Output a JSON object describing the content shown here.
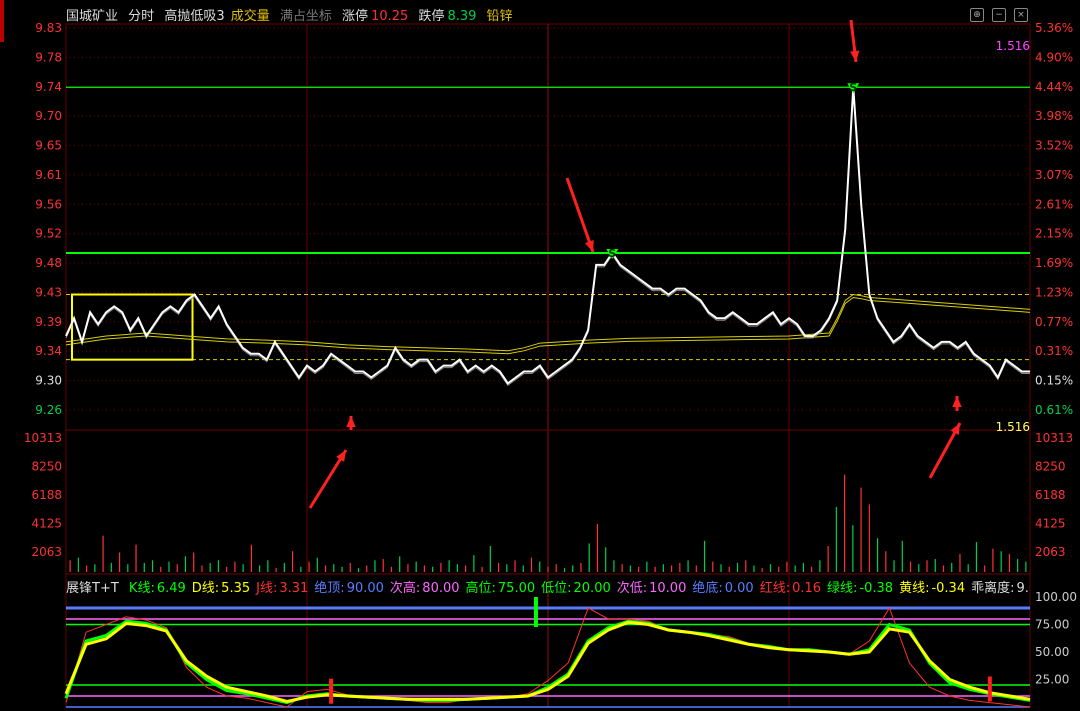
{
  "header": {
    "stock_name": "国城矿业",
    "mode": "分时",
    "indicator": "高抛低吸3",
    "volume_label": "成交量",
    "full_coord_label": "满占坐标",
    "limit_up_label": "涨停",
    "limit_up_value": "10.25",
    "limit_down_label": "跌停",
    "limit_down_value": "8.39",
    "sector": "铅锌"
  },
  "indicator_bar": {
    "name": "展锋T+T",
    "items": [
      {
        "label": "K线:",
        "value": "6.49",
        "color": "#00ff00"
      },
      {
        "label": "D线:",
        "value": "5.35",
        "color": "#ffff00"
      },
      {
        "label": "J线:",
        "value": "3.31",
        "color": "#ff3030"
      },
      {
        "label": "绝顶:",
        "value": "90.00",
        "color": "#5b7cff"
      },
      {
        "label": "次高:",
        "value": "80.00",
        "color": "#ff66ff"
      },
      {
        "label": "高位:",
        "value": "75.00",
        "color": "#00ff00"
      },
      {
        "label": "低位:",
        "value": "20.00",
        "color": "#00ff00"
      },
      {
        "label": "次低:",
        "value": "10.00",
        "color": "#ff66ff"
      },
      {
        "label": "绝底:",
        "value": "0.00",
        "color": "#5b7cff"
      },
      {
        "label": "红线:",
        "value": "0.16",
        "color": "#ff3030"
      },
      {
        "label": "绿线:",
        "value": "-0.38",
        "color": "#00ff00"
      },
      {
        "label": "黄线:",
        "value": "-0.34",
        "color": "#ffff00"
      },
      {
        "label": "乖离度:",
        "value": "9.",
        "color": "#dddddd"
      }
    ]
  },
  "colors": {
    "up": "#ff3232",
    "down": "#00d050",
    "price_line": "#ffffff",
    "avg_line": "#d8d000",
    "grid": "#6b0000",
    "ma_level": "#00ff00",
    "arrow": "#ff2020"
  },
  "chart_data": [
    {
      "type": "line",
      "name": "price",
      "y_left_ticks": [
        "9.83",
        "9.78",
        "9.74",
        "9.70",
        "9.65",
        "9.61",
        "9.56",
        "9.52",
        "9.48",
        "9.43",
        "9.39",
        "9.34",
        "9.30",
        "9.26"
      ],
      "y_right_ticks": [
        "5.36%",
        "4.90%",
        "4.44%",
        "3.98%",
        "3.52%",
        "3.07%",
        "2.61%",
        "2.15%",
        "1.69%",
        "1.23%",
        "0.77%",
        "0.31%",
        "0.15%",
        "0.61%"
      ],
      "ylim": [
        9.215,
        9.86
      ],
      "prev_close": 9.3,
      "value_label": "1.516",
      "price_x": [
        0,
        2,
        4,
        6,
        8,
        10,
        12,
        14,
        16,
        18,
        20,
        22,
        24,
        26,
        28,
        30,
        32,
        34,
        36,
        38,
        40,
        42,
        44,
        46,
        48,
        50,
        52,
        54,
        56,
        58,
        60,
        62,
        64,
        66,
        68,
        70,
        72,
        74,
        76,
        78,
        80,
        82,
        84,
        86,
        88,
        90,
        92,
        94,
        96,
        98,
        100,
        102,
        104,
        106,
        108,
        110,
        112,
        114,
        116,
        118,
        120,
        122,
        124,
        126,
        128,
        130,
        132,
        134,
        136,
        138,
        140,
        142,
        144,
        146,
        148,
        150,
        152,
        154,
        156,
        158,
        160,
        162,
        164,
        166,
        168,
        170,
        172,
        174,
        176,
        178,
        180,
        182,
        184,
        186,
        188,
        190,
        192,
        194,
        196,
        198,
        200,
        202,
        204,
        206,
        208,
        210,
        212,
        214,
        216,
        218,
        220,
        222,
        224,
        226,
        228,
        230,
        232,
        234,
        236,
        238,
        240
      ],
      "price": [
        9.34,
        9.37,
        9.33,
        9.38,
        9.36,
        9.38,
        9.39,
        9.38,
        9.35,
        9.37,
        9.34,
        9.36,
        9.38,
        9.39,
        9.38,
        9.4,
        9.41,
        9.39,
        9.37,
        9.39,
        9.36,
        9.34,
        9.32,
        9.31,
        9.31,
        9.3,
        9.33,
        9.31,
        9.29,
        9.27,
        9.29,
        9.28,
        9.29,
        9.31,
        9.3,
        9.29,
        9.28,
        9.28,
        9.27,
        9.28,
        9.29,
        9.32,
        9.3,
        9.29,
        9.3,
        9.3,
        9.28,
        9.29,
        9.29,
        9.3,
        9.28,
        9.29,
        9.28,
        9.29,
        9.28,
        9.26,
        9.27,
        9.28,
        9.28,
        9.29,
        9.27,
        9.28,
        9.29,
        9.3,
        9.32,
        9.35,
        9.46,
        9.46,
        9.48,
        9.46,
        9.45,
        9.44,
        9.43,
        9.42,
        9.42,
        9.41,
        9.42,
        9.42,
        9.41,
        9.4,
        9.38,
        9.37,
        9.37,
        9.38,
        9.37,
        9.36,
        9.36,
        9.37,
        9.38,
        9.36,
        9.37,
        9.36,
        9.34,
        9.34,
        9.35,
        9.37,
        9.4,
        9.52,
        9.76,
        9.56,
        9.41,
        9.37,
        9.35,
        9.33,
        9.34,
        9.36,
        9.34,
        9.33,
        9.32,
        9.33,
        9.33,
        9.32,
        9.33,
        9.31,
        9.3,
        9.29,
        9.27,
        9.3,
        9.29,
        9.28,
        9.28
      ],
      "avg_x": [
        0,
        10,
        20,
        30,
        40,
        50,
        60,
        70,
        80,
        90,
        100,
        110,
        114,
        118,
        130,
        140,
        150,
        160,
        170,
        180,
        190,
        192,
        194,
        196,
        198,
        200,
        210,
        220,
        230,
        240
      ],
      "avg": [
        9.33,
        9.34,
        9.345,
        9.34,
        9.335,
        9.333,
        9.33,
        9.325,
        9.322,
        9.32,
        9.318,
        9.315,
        9.32,
        9.328,
        9.333,
        9.336,
        9.337,
        9.338,
        9.339,
        9.34,
        9.345,
        9.37,
        9.4,
        9.41,
        9.408,
        9.405,
        9.4,
        9.395,
        9.39,
        9.385
      ],
      "resistance_lines": [
        9.76,
        9.48
      ],
      "dashed_levels": [
        9.41,
        9.3
      ],
      "highlight_box": {
        "x_from": 0,
        "x_to": 30,
        "y_from": 9.3,
        "y_to": 9.41
      },
      "signal_markers": [
        {
          "x": 136,
          "y": 9.48,
          "label": "S"
        },
        {
          "x": 196,
          "y": 9.76,
          "label": "S"
        }
      ]
    },
    {
      "type": "bar",
      "name": "volume",
      "y_ticks": [
        "10313",
        "8250",
        "6188",
        "4125",
        "2063"
      ],
      "ylim": [
        0,
        10313
      ],
      "values": [
        900,
        1100,
        500,
        600,
        2800,
        700,
        1500,
        600,
        2100,
        700,
        900,
        400,
        800,
        600,
        1200,
        1500,
        500,
        700,
        900,
        400,
        800,
        600,
        2100,
        500,
        900,
        300,
        700,
        1600,
        400,
        800,
        1100,
        500,
        600,
        400,
        700,
        300,
        500,
        900,
        1000,
        400,
        1200,
        600,
        800,
        500,
        400,
        700,
        900,
        600,
        500,
        1300,
        400,
        2000,
        700,
        600,
        900,
        500,
        1100,
        800,
        400,
        600,
        300,
        500,
        700,
        2200,
        3700,
        1900,
        900,
        600,
        500,
        400,
        800,
        400,
        600,
        500,
        700,
        900,
        500,
        2400,
        800,
        600,
        400,
        700,
        900,
        500,
        300,
        600,
        400,
        800,
        500,
        700,
        400,
        900,
        2000,
        5000,
        7500,
        3600,
        6500,
        5200,
        2600,
        1600,
        900,
        2400,
        800,
        600,
        900,
        1000,
        500,
        700,
        1400,
        600,
        2300,
        500,
        1800,
        1600,
        1400,
        1000,
        800
      ],
      "colors": "rgrgrgrgrggrgrgrrggrrgrggrgrgrgrggrgrgrrgrgrgrggrgrgrgrgrgrrggrgrggrgrgrgrrgrgrgrgrgrgrrggrgrgrgrrgrggrgrgrgrggrrgrgg",
      "bottom_value": "1.516"
    },
    {
      "type": "line",
      "name": "展锋T+T",
      "y_ticks": [
        "100.00",
        "75.00",
        "50.00",
        "25.00"
      ],
      "ylim": [
        0,
        100
      ],
      "levels": [
        {
          "value": 90,
          "color": "#5b7cff"
        },
        {
          "value": 80,
          "color": "#ff66ff"
        },
        {
          "value": 75,
          "color": "#00ff00"
        },
        {
          "value": 20,
          "color": "#00ff00"
        },
        {
          "value": 10,
          "color": "#ff66ff"
        },
        {
          "value": 0,
          "color": "#5b7cff"
        }
      ],
      "x": [
        0,
        5,
        10,
        15,
        20,
        25,
        30,
        35,
        40,
        45,
        50,
        55,
        60,
        65,
        70,
        75,
        80,
        85,
        90,
        95,
        100,
        105,
        110,
        115,
        120,
        125,
        130,
        135,
        140,
        145,
        150,
        155,
        160,
        165,
        170,
        175,
        180,
        185,
        190,
        195,
        200,
        205,
        210,
        215,
        220,
        225,
        230,
        235,
        240
      ],
      "series": [
        {
          "name": "K线",
          "color": "#00ff00",
          "values": [
            8,
            60,
            65,
            78,
            76,
            70,
            40,
            25,
            15,
            12,
            8,
            4,
            10,
            12,
            10,
            9,
            8,
            7,
            6,
            6,
            7,
            8,
            9,
            10,
            18,
            30,
            60,
            72,
            78,
            76,
            70,
            68,
            66,
            62,
            57,
            55,
            52,
            52,
            50,
            48,
            52,
            75,
            70,
            40,
            22,
            16,
            12,
            9,
            6
          ]
        },
        {
          "name": "D线",
          "color": "#ffff00",
          "values": [
            12,
            57,
            62,
            76,
            74,
            69,
            42,
            28,
            18,
            14,
            10,
            5,
            9,
            11,
            10,
            9,
            8,
            7,
            7,
            7,
            7,
            8,
            9,
            10,
            16,
            28,
            58,
            70,
            77,
            75,
            70,
            68,
            65,
            61,
            57,
            54,
            52,
            51,
            50,
            48,
            50,
            71,
            68,
            42,
            25,
            18,
            13,
            10,
            7
          ]
        },
        {
          "name": "J线",
          "color": "#ff3030",
          "values": [
            4,
            68,
            75,
            82,
            79,
            72,
            36,
            18,
            10,
            8,
            4,
            0,
            14,
            16,
            11,
            9,
            7,
            6,
            4,
            4,
            7,
            9,
            9,
            12,
            24,
            40,
            90,
            80,
            80,
            78,
            70,
            68,
            66,
            64,
            58,
            56,
            52,
            53,
            50,
            48,
            60,
            90,
            40,
            18,
            10,
            6,
            4,
            2,
            0
          ]
        }
      ],
      "markers": [
        {
          "x": 117,
          "value": 100,
          "color": "#00ff00"
        },
        {
          "x": 230,
          "value": 5,
          "color": "#ff2020"
        },
        {
          "x": 66,
          "value": 3,
          "color": "#ff2020"
        }
      ]
    }
  ],
  "annotations": {
    "arrows": [
      "arrow-to-s1",
      "arrow-to-s2",
      "arrow-up-bottom-1",
      "arrow-up-bottom-2"
    ]
  }
}
